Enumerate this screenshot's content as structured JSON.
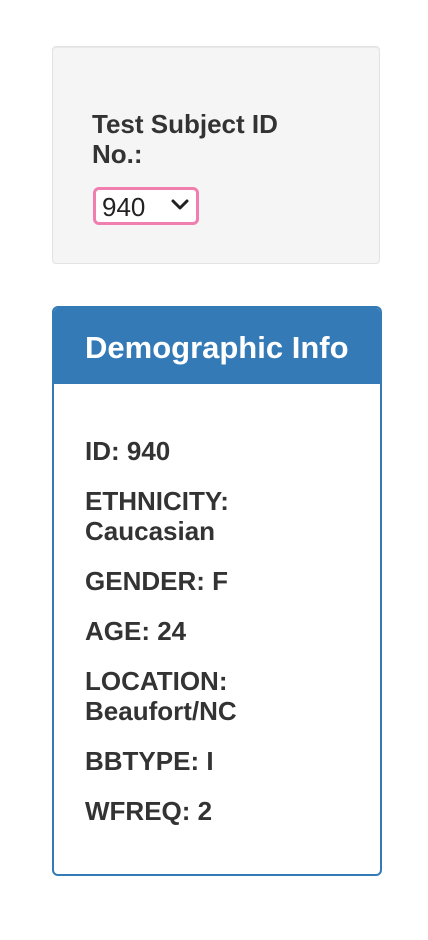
{
  "selector": {
    "label": "Test Subject ID No.:",
    "selected_value": "940",
    "accent_color": "#f07fb0"
  },
  "panel": {
    "title": "Demographic Info",
    "header_color": "#337ab7",
    "rows": [
      "ID: 940",
      "ETHNICITY: Caucasian",
      "GENDER: F",
      "AGE: 24",
      "LOCATION: Beaufort/NC",
      "BBTYPE: I",
      "WFREQ: 2"
    ]
  }
}
